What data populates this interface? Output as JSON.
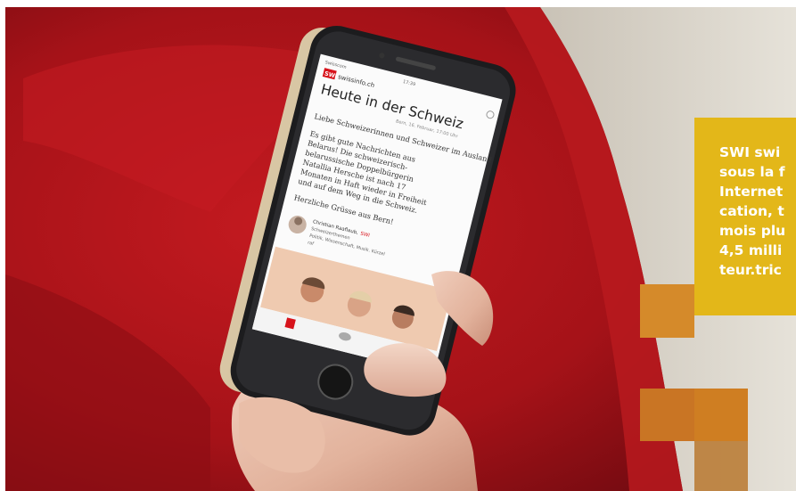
{
  "photo": {
    "description_free": true,
    "phone_app": {
      "status_left": "Swisscom",
      "status_time": "17:39",
      "logo": "SWI",
      "site": "swissinfo.ch",
      "heading": "Heute in der Schweiz",
      "dateline": "Bern, 16. Februar, 17:00 Uhr",
      "greeting": "Liebe Schweizerinnen und Schweizer im Ausland",
      "body_lines": [
        "Es gibt gute Nachrichten aus",
        "Belarus! Die schweizerisch-",
        "belarussische Doppelbürgerin",
        "Natallia Hersche ist nach 17",
        "Monaten in Haft wieder in Freiheit",
        "und auf dem Weg in die Schweiz."
      ],
      "sign_off": "Herzliche Grüsse aus Bern!",
      "author_name": "Christian Raaflaub,",
      "author_brand": "SWI",
      "author_role": "Schweizerthemen",
      "author_topics": "Politik, Wissenschaft, Musik. Kürzel",
      "author_tag": "raf",
      "tab_icons": [
        "home-icon",
        "chat-icon",
        "person-icon"
      ]
    }
  },
  "callout": {
    "text": "SWI swi\nsous la f\nInternet\ncation, t\nmois plu\n4,5 milli\nteur.tric"
  },
  "colors": {
    "sofa_red": "#b0141c",
    "callout_yellow": "#e3b719",
    "tile_orange": "#d6822a",
    "tile_dark_orange": "#c9721f"
  }
}
